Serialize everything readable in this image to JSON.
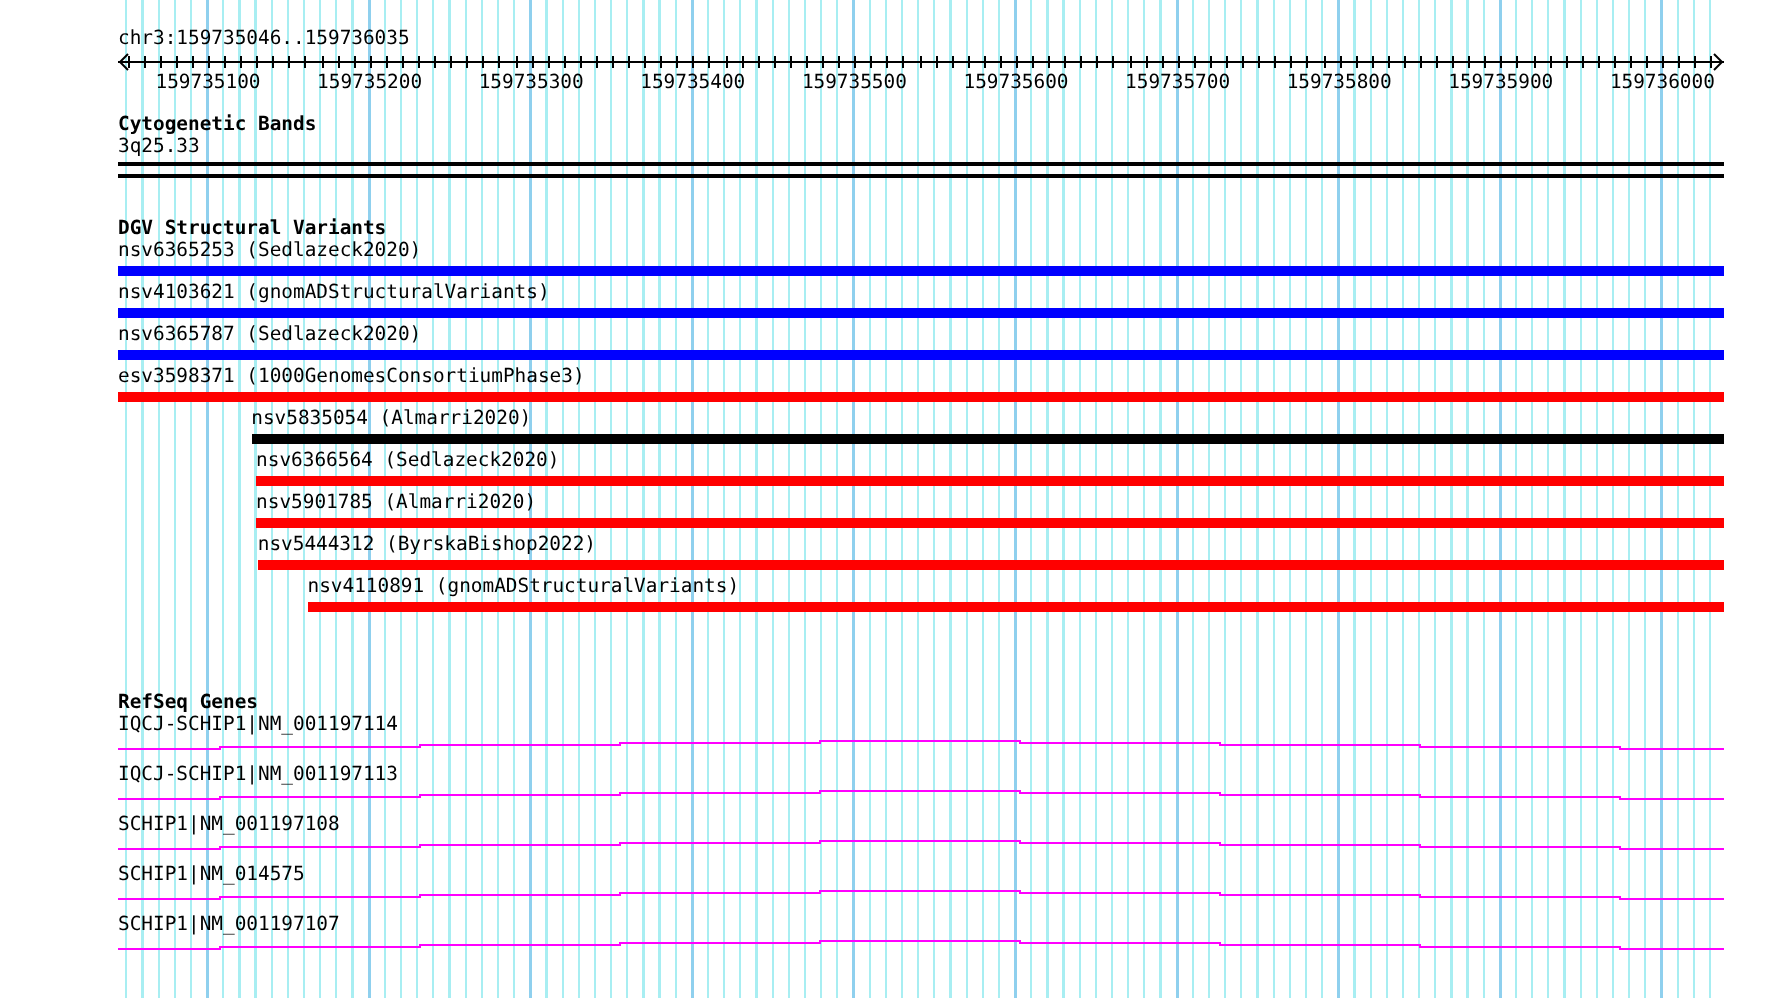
{
  "location": "chr3:159735046..159736035",
  "ruler": {
    "ticks": [
      "159735100",
      "159735200",
      "159735300",
      "159735400",
      "159735500",
      "159735600",
      "159735700",
      "159735800",
      "159735900",
      "159736000"
    ]
  },
  "tracks": [
    {
      "kind": "bands",
      "title": "Cytogenetic Bands",
      "items": [
        {
          "label": "3q25.33"
        }
      ]
    },
    {
      "kind": "variants",
      "title": "DGV Structural Variants",
      "items": [
        {
          "label": "nsv6365253 (Sedlazeck2020)",
          "color": "#0000ff",
          "level": 1
        },
        {
          "label": "nsv4103621 (gnomADStructuralVariants)",
          "color": "#0000ff",
          "level": 1
        },
        {
          "label": "nsv6365787 (Sedlazeck2020)",
          "color": "#0000ff",
          "level": 1
        },
        {
          "label": "esv3598371 (1000GenomesConsortiumPhase3)",
          "color": "#ff0000",
          "level": 1
        },
        {
          "label": "nsv5835054 (Almarri2020)",
          "color": "#000000",
          "level": 0.917
        },
        {
          "label": "nsv6366564 (Sedlazeck2020)",
          "color": "#ff0000",
          "level": 0.914
        },
        {
          "label": "nsv5901785 (Almarri2020)",
          "color": "#ff0000",
          "level": 0.914
        },
        {
          "label": "nsv5444312 (ByrskaBishop2022)",
          "color": "#ff0000",
          "level": 0.913
        },
        {
          "label": "nsv4110891 (gnomADStructuralVariants)",
          "color": "#ff0000",
          "level": 0.882
        }
      ]
    },
    {
      "kind": "genes",
      "title": "RefSeq Genes",
      "items": [
        {
          "label": "IQCJ-SCHIP1|NM_001197114"
        },
        {
          "label": "IQCJ-SCHIP1|NM_001197113"
        },
        {
          "label": "SCHIP1|NM_001197108"
        },
        {
          "label": "SCHIP1|NM_014575"
        },
        {
          "label": "SCHIP1|NM_001197107"
        }
      ]
    }
  ]
}
